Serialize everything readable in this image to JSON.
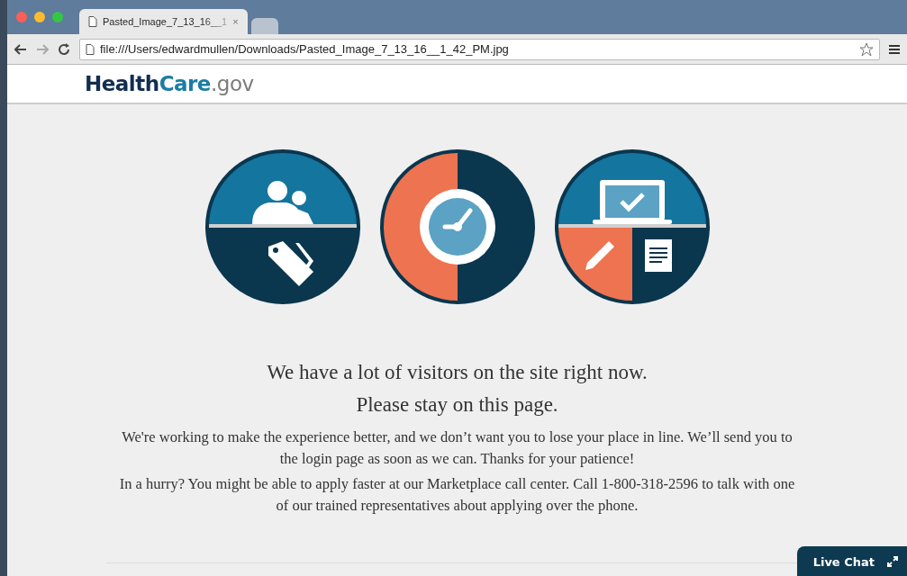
{
  "browser": {
    "tabs": [
      {
        "title": "Pasted_Image_7_13_16__1",
        "selected": true,
        "close": "×"
      },
      {
        "selected": false
      }
    ],
    "address": "file:///Users/edwardmullen/Downloads/Pasted_Image_7_13_16__1_42_PM.jpg"
  },
  "logo": {
    "primary": "Health",
    "accent": "Care",
    "suffix": ".gov"
  },
  "heading": [
    "We have a lot of visitors on the site right now.",
    "Please stay on this page."
  ],
  "paragraphs": [
    "We're working to make the experience better, and we don’t want you to lose your place in line. We’ll send you to the login page as soon as we can. Thanks for your patience!",
    "In a hurry? You might be able to apply faster at our Marketplace call center. Call 1-800-318-2596 to talk with one of our trained representatives about applying over the phone."
  ],
  "chat": {
    "label": "Live Chat"
  }
}
